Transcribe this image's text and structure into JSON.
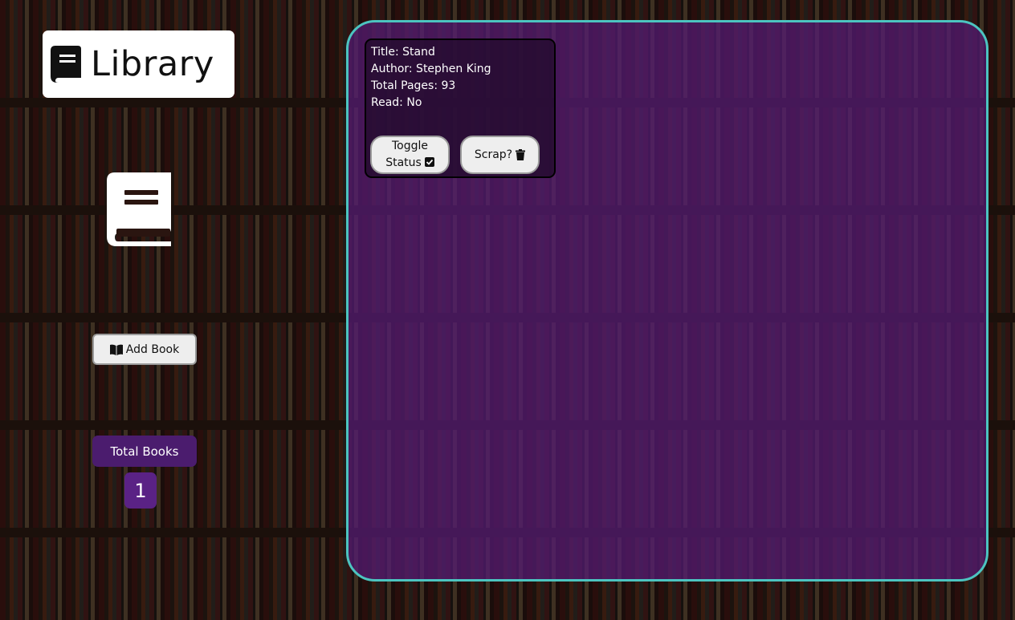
{
  "logo": {
    "text": "Library",
    "icon": "book-icon"
  },
  "sidebar": {
    "hero_icon": "book-icon",
    "add_book_label": "Add Book",
    "add_book_icon": "book-open-icon",
    "total_books_label": "Total Books",
    "total_books_count": "1"
  },
  "books": [
    {
      "title_line": "Title: Stand",
      "author_line": "Author: Stephen King",
      "pages_line": "Total Pages: 93",
      "read_line": "Read: No",
      "toggle_label_1": "Toggle",
      "toggle_label_2": "Status",
      "toggle_icon": "checkbox-checked-icon",
      "scrap_label": "Scrap?",
      "scrap_icon": "trash-icon"
    }
  ],
  "colors": {
    "panel_border": "#4cc4c0",
    "panel_fill": "#561c76",
    "total_label_bg": "#4b1c6e",
    "total_count_bg": "#5a2285"
  }
}
